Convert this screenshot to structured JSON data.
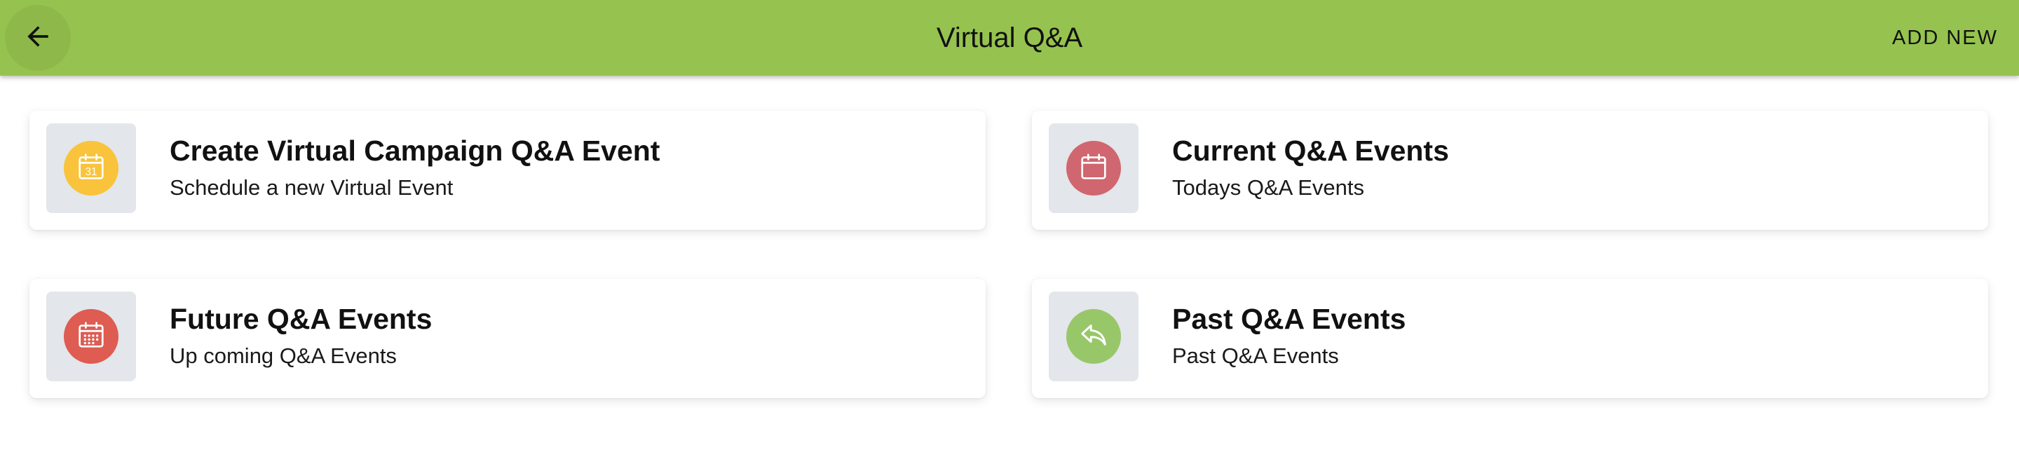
{
  "appbar": {
    "title": "Virtual Q&A",
    "action_label": "ADD NEW",
    "back_icon": "arrow-left-icon",
    "background": "#96c34f"
  },
  "cards": [
    {
      "title": "Create Virtual Campaign Q&A Event",
      "subtitle": "Schedule a new Virtual Event",
      "icon": "calendar-31-icon",
      "icon_text": "31",
      "icon_color": "#f9c33b"
    },
    {
      "title": "Current Q&A Events",
      "subtitle": "Todays Q&A Events",
      "icon": "calendar-blank-icon",
      "icon_color": "#d0666f"
    },
    {
      "title": "Future Q&A Events",
      "subtitle": "Up coming Q&A Events",
      "icon": "calendar-grid-icon",
      "icon_color": "#de5c52"
    },
    {
      "title": "Past Q&A Events",
      "subtitle": "Past Q&A Events",
      "icon": "reply-arrow-icon",
      "icon_color": "#98c769"
    }
  ]
}
